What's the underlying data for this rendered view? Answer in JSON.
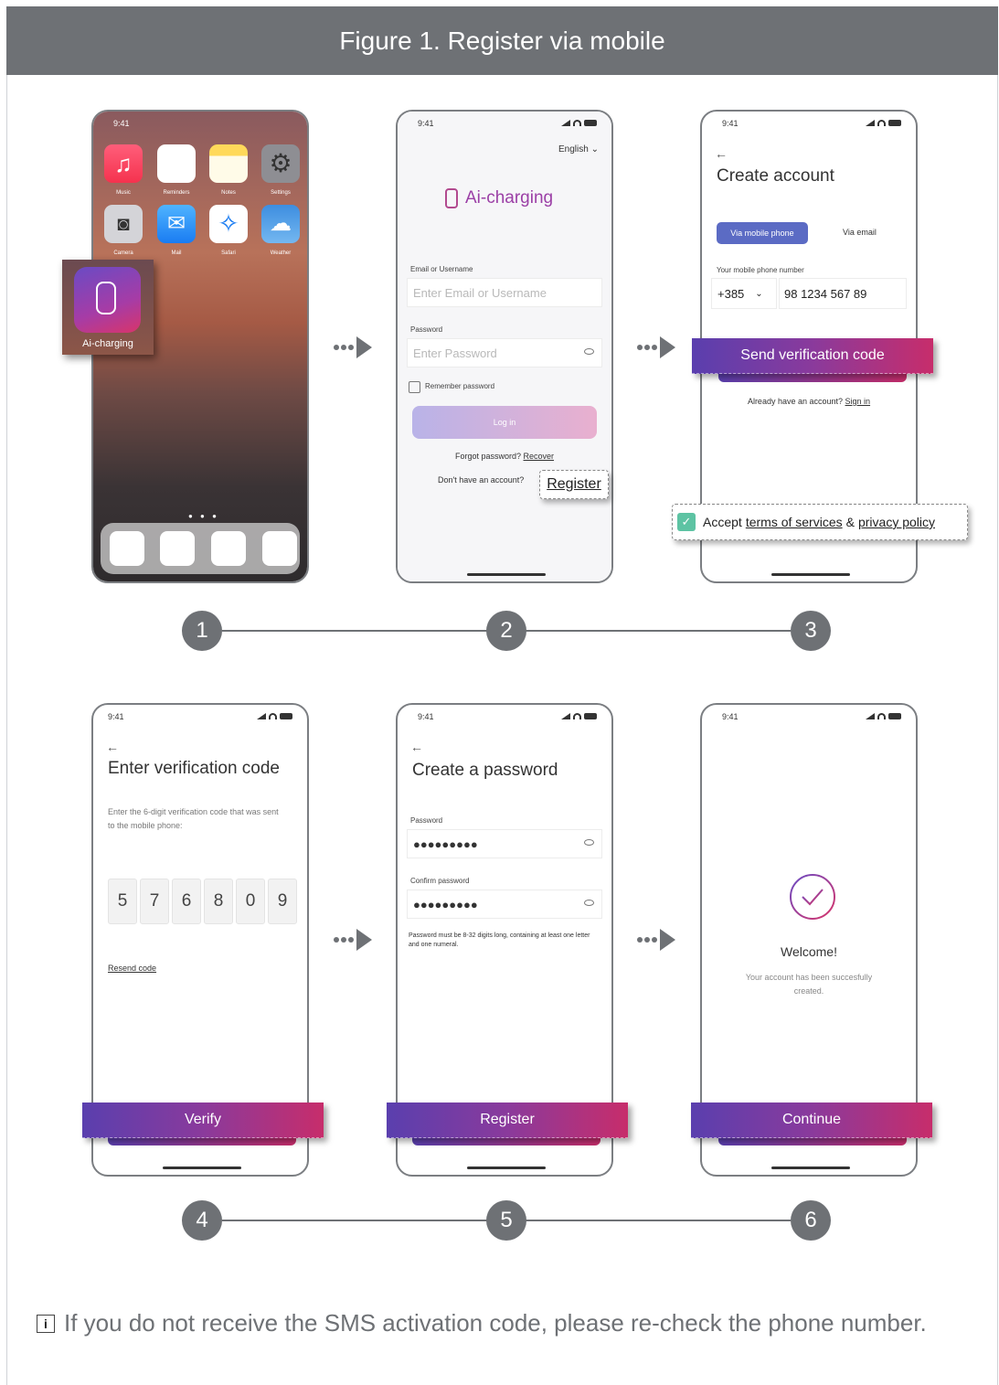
{
  "header": {
    "title": "Figure 1. Register via mobile"
  },
  "status_time": "9:41",
  "screen1": {
    "apps": [
      "Music",
      "Reminders",
      "Notes",
      "Settings",
      "Camera",
      "Mail",
      "Safari",
      "Weather"
    ],
    "featured_app": "Ai-charging"
  },
  "screen2": {
    "language": "English",
    "brand": "Ai-charging",
    "email_label": "Email or Username",
    "email_placeholder": "Enter Email or Username",
    "password_label": "Password",
    "password_placeholder": "Enter Password",
    "remember": "Remember password",
    "login": "Log in",
    "forgot": "Forgot password?",
    "recover": "Recover",
    "no_account": "Don't have an account?",
    "register": "Register"
  },
  "screen3": {
    "title": "Create account",
    "tab_mobile": "Via mobile phone",
    "tab_email": "Via email",
    "phone_label": "Your mobile phone number",
    "country_code": "+385",
    "phone_number": "98 1234 567 89",
    "send_button": "Send verification code",
    "already": "Already have an account?",
    "sign_in": "Sign in",
    "accept": "Accept",
    "terms": "terms of services",
    "amp": "&",
    "privacy": "privacy policy"
  },
  "screen4": {
    "title": "Enter verification code",
    "desc": "Enter the 6-digit verification code that was sent to the mobile phone:",
    "digits": [
      "5",
      "7",
      "6",
      "8",
      "0",
      "9"
    ],
    "resend": "Resend code",
    "button": "Verify"
  },
  "screen5": {
    "title": "Create a password",
    "password_label": "Password",
    "password_value": "●●●●●●●●●",
    "confirm_label": "Confirm password",
    "confirm_value": "●●●●●●●●●",
    "hint": "Password must be 8-32 digits long, containing at least one letter and one numeral.",
    "button": "Register"
  },
  "screen6": {
    "welcome": "Welcome!",
    "desc": "Your account has been succesfully created.",
    "button": "Continue"
  },
  "steps": [
    "1",
    "2",
    "3",
    "4",
    "5",
    "6"
  ],
  "note": {
    "icon": "i",
    "text": "If you do not receive the SMS activation code, please re-check the phone number."
  },
  "colors": {
    "header": "#6e7175",
    "accent_purple": "#5a3fae",
    "accent_pink": "#c72d6b",
    "tab_active": "#5b6bc4"
  }
}
